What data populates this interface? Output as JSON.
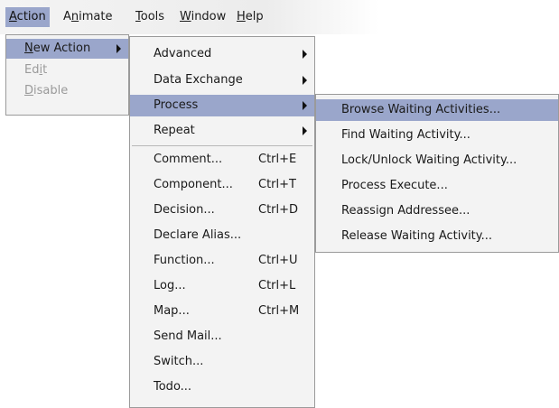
{
  "menubar": {
    "items": [
      {
        "prefix": "",
        "mnemonic": "A",
        "rest": "ction"
      },
      {
        "prefix": "A",
        "mnemonic": "n",
        "rest": "imate"
      },
      {
        "prefix": "",
        "mnemonic": "T",
        "rest": "ools"
      },
      {
        "prefix": "",
        "mnemonic": "W",
        "rest": "indow"
      },
      {
        "prefix": "",
        "mnemonic": "H",
        "rest": "elp"
      }
    ]
  },
  "action_menu": {
    "items": [
      {
        "prefix": "",
        "mnemonic": "N",
        "rest": "ew Action"
      },
      {
        "prefix": "Ed",
        "mnemonic": "i",
        "rest": "t"
      },
      {
        "prefix": "",
        "mnemonic": "D",
        "rest": "isable"
      }
    ]
  },
  "new_action_menu": {
    "items": [
      {
        "label": "Advanced",
        "shortcut": ""
      },
      {
        "label": "Data Exchange",
        "shortcut": ""
      },
      {
        "label": "Process",
        "shortcut": ""
      },
      {
        "label": "Repeat",
        "shortcut": ""
      },
      {
        "label": "Comment...",
        "shortcut": "Ctrl+E"
      },
      {
        "label": "Component...",
        "shortcut": "Ctrl+T"
      },
      {
        "label": "Decision...",
        "shortcut": "Ctrl+D"
      },
      {
        "label": "Declare Alias...",
        "shortcut": ""
      },
      {
        "label": "Function...",
        "shortcut": "Ctrl+U"
      },
      {
        "label": "Log...",
        "shortcut": "Ctrl+L"
      },
      {
        "label": "Map...",
        "shortcut": "Ctrl+M"
      },
      {
        "label": "Send Mail...",
        "shortcut": ""
      },
      {
        "label": "Switch...",
        "shortcut": ""
      },
      {
        "label": "Todo...",
        "shortcut": ""
      }
    ]
  },
  "process_menu": {
    "items": [
      {
        "label": "Browse Waiting Activities..."
      },
      {
        "label": "Find Waiting Activity..."
      },
      {
        "label": "Lock/Unlock Waiting Activity..."
      },
      {
        "label": "Process Execute..."
      },
      {
        "label": "Reassign Addressee..."
      },
      {
        "label": "Release Waiting Activity..."
      }
    ]
  },
  "colors": {
    "highlight": "#9aa6cb",
    "menu_bg": "#f3f3f3",
    "disabled_text": "#9a9a9a"
  }
}
